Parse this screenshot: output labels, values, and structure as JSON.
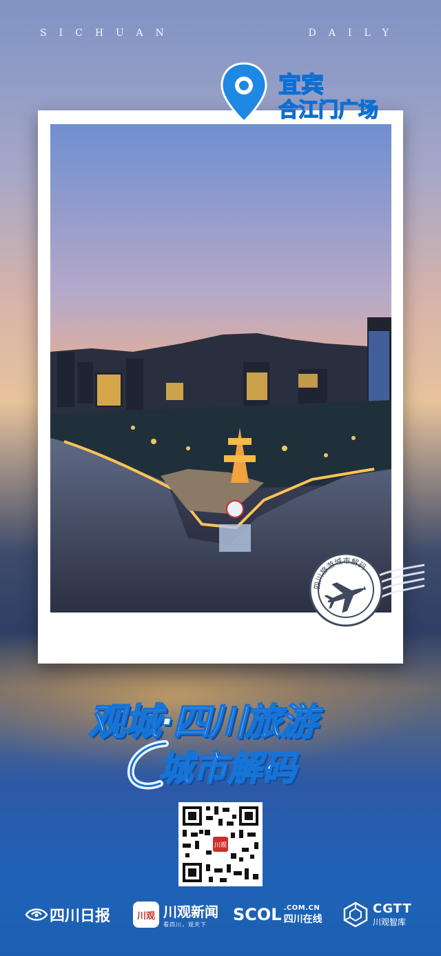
{
  "header": {
    "left_word": "SICHUAN",
    "right_word": "DAILY"
  },
  "location": {
    "city": "宜宾",
    "place": "合江门广场"
  },
  "stamp": {
    "ring_text": "四川旅游城市解码"
  },
  "title": {
    "line1": "观城·四川旅游",
    "line2": "城市解码"
  },
  "qr": {
    "center_label": "川观"
  },
  "footer": {
    "sichuan_daily": "四川日报",
    "chuanguan_badge": "川观",
    "chuanguan_name": "川观新闻",
    "chuanguan_slogan": "看四川，观天下",
    "scol_main": "SCOL",
    "scol_domain": ".COM.CN",
    "scol_name": "四川在线",
    "cgtt_main": "CGTT",
    "cgtt_name": "川观智库"
  },
  "colors": {
    "accent_blue": "#1773d6",
    "pin_blue": "#1e88e5",
    "frame": "#ffffff"
  },
  "icons": [
    "location-pin-icon",
    "airplane-icon",
    "qr-code",
    "sichuan-daily-logo-icon",
    "cgtt-logo-icon"
  ]
}
